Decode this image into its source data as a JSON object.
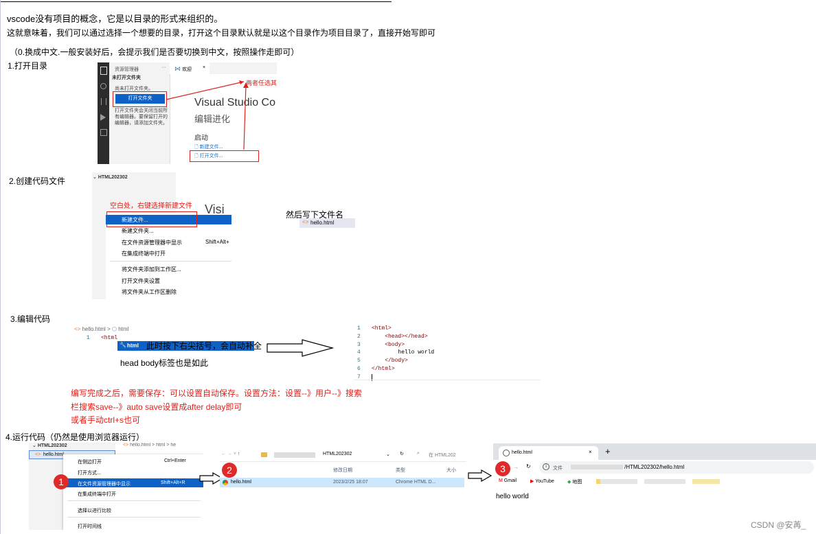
{
  "intro": {
    "line1": "vscode没有项目的概念，它是以目录的形式来组织的。",
    "line2": "这就意味着，我们可以通过选择一个想要的目录，打开这个目录默认就是以这个目录作为项目目录了，直接开始写即可",
    "note": "（0.换成中文.一般安装好后，会提示我们是否要切换到中文，按照操作走即可）"
  },
  "step1": {
    "label": "1.打开目录",
    "explorer_title": "资源管理器",
    "explorer_subtitle": "未打开文件夹",
    "explorer_hint": "尚未打开文件夹。",
    "open_folder_btn": "打开文件夹",
    "explorer_desc": "打开文件夹会关闭当前所有编辑器。要保留打开的编辑器，请添加文件夹。",
    "tab_welcome": "欢迎",
    "annotation": "两者任选其一",
    "vs_title": "Visual Studio Co",
    "vs_subtitle": "编辑进化",
    "start_heading": "启动",
    "new_file": "新建文件...",
    "open_file": "打开文件..."
  },
  "step2": {
    "label": "2.创建代码文件",
    "folder_name": "HTML202302",
    "annotation": "空白处，右键选择新建文件",
    "vis_text": "Visi",
    "menu": [
      "新建文件...",
      "新建文件夹...",
      "在文件资源管理器中显示",
      "在集成终端中打开",
      "将文件夹添加到工作区...",
      "打开文件夹设置",
      "将文件夹从工作区删除"
    ],
    "menu_shortcut": "Shift+Alt+",
    "then_label": "然后写下文件名",
    "filename": "hello.html"
  },
  "step3": {
    "label": "3.编辑代码",
    "breadcrumb_file": "hello.html",
    "breadcrumb_sep": ">",
    "breadcrumb_tag": "html",
    "line_no": "1",
    "typed": "<html",
    "suggestion": "html",
    "annotation1": "此时按下右尖括号，会自动补全",
    "annotation2": "head body标签也是如此",
    "code_lines": [
      {
        "n": "1",
        "code": "<html>"
      },
      {
        "n": "2",
        "code": "    <head></head>"
      },
      {
        "n": "3",
        "code": "    <body>"
      },
      {
        "n": "4",
        "code": "        hello world"
      },
      {
        "n": "5",
        "code": "    </body>"
      },
      {
        "n": "6",
        "code": "</html>"
      },
      {
        "n": "7",
        "code": ""
      }
    ],
    "save_note1": "编写完成之后，需要保存：可以设置自动保存。设置方法：设置--》用户--》搜索",
    "save_note2": "栏搜索save--》auto save设置成after delay即可",
    "save_note3": "或者手动ctrl+s也可"
  },
  "step4": {
    "label": "4.运行代码（仍然是使用浏览器运行）",
    "folder_name": "HTML202302",
    "file_name": "hello.html",
    "crumb_file": "hello.html",
    "crumb_tag": "html",
    "crumb_he": "he",
    "menu": [
      {
        "label": "在侧边打开",
        "shortcut": "Ctrl+Enter"
      },
      {
        "label": "打开方式...",
        "shortcut": ""
      },
      {
        "label": "在文件资源管理器中显示",
        "shortcut": "Shift+Alt+R"
      },
      {
        "label": "在集成终端中打开",
        "shortcut": ""
      },
      {
        "label": "选择以进行比较",
        "shortcut": ""
      },
      {
        "label": "打开时间线",
        "shortcut": ""
      }
    ],
    "badge1": "1",
    "badge2": "2",
    "badge3": "3",
    "fe_path": "HTML202302",
    "fe_search": "在 HTML202",
    "fe_col_date": "修改日期",
    "fe_col_type": "类型",
    "fe_col_size": "大小",
    "fe_file": "hello.html",
    "fe_date": "2023/2/25 18:07",
    "fe_type": "Chrome HTML D...",
    "br_tab": "hello.html",
    "br_tab_close": "×",
    "br_new_tab": "+",
    "br_file_label": "文件",
    "br_url": "/HTML202302/hello.html",
    "bm_gmail": "Gmail",
    "bm_youtube": "YouTube",
    "bm_map": "地图",
    "page_text": "hello world"
  },
  "watermark": "CSDN @安苒_"
}
